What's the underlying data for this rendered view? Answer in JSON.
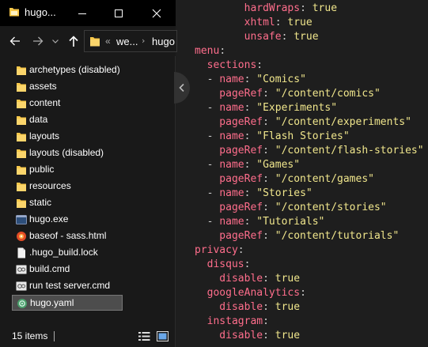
{
  "window": {
    "title": "hugo..."
  },
  "address_bar": {
    "overflow": "«",
    "segment1": "we...",
    "segment2": "hugo"
  },
  "files": [
    {
      "name": "archetypes (disabled)",
      "icon": "folder-icon"
    },
    {
      "name": "assets",
      "icon": "folder-icon"
    },
    {
      "name": "content",
      "icon": "folder-icon"
    },
    {
      "name": "data",
      "icon": "folder-icon"
    },
    {
      "name": "layouts",
      "icon": "folder-icon"
    },
    {
      "name": "layouts (disabled)",
      "icon": "folder-icon"
    },
    {
      "name": "public",
      "icon": "folder-icon"
    },
    {
      "name": "resources",
      "icon": "folder-icon"
    },
    {
      "name": "static",
      "icon": "folder-icon"
    },
    {
      "name": "hugo.exe",
      "icon": "exe-icon"
    },
    {
      "name": "baseof - sass.html",
      "icon": "html-file-icon"
    },
    {
      "name": ".hugo_build.lock",
      "icon": "blank-file-icon"
    },
    {
      "name": "build.cmd",
      "icon": "cmd-file-icon"
    },
    {
      "name": "run test server.cmd",
      "icon": "cmd-file-icon"
    },
    {
      "name": "hugo.yaml",
      "icon": "yaml-file-icon",
      "selected": true
    }
  ],
  "status": {
    "item_count": "15 items"
  },
  "colors": {
    "key": "#ff6e8c",
    "value": "#f0e68c",
    "punct": "#cccccc",
    "background": "#1e1e1e",
    "folder": "#f8c84a",
    "selection": "#4d4d4d"
  },
  "code_lines": [
    [
      [
        "k",
        "        hardWraps"
      ],
      [
        "p",
        ": "
      ],
      [
        "b",
        "true"
      ]
    ],
    [
      [
        "k",
        "        xhtml"
      ],
      [
        "p",
        ": "
      ],
      [
        "b",
        "true"
      ]
    ],
    [
      [
        "k",
        "        unsafe"
      ],
      [
        "p",
        ": "
      ],
      [
        "b",
        "true"
      ]
    ],
    [
      [
        "k",
        "menu"
      ],
      [
        "p",
        ":"
      ]
    ],
    [
      [
        "k",
        "  sections"
      ],
      [
        "p",
        ":"
      ]
    ],
    [
      [
        "p",
        "  - "
      ],
      [
        "k",
        "name"
      ],
      [
        "p",
        ": "
      ],
      [
        "s",
        "\"Comics\""
      ]
    ],
    [
      [
        "k",
        "    pageRef"
      ],
      [
        "p",
        ": "
      ],
      [
        "s",
        "\"/content/comics\""
      ]
    ],
    [
      [
        "p",
        "  - "
      ],
      [
        "k",
        "name"
      ],
      [
        "p",
        ": "
      ],
      [
        "s",
        "\"Experiments\""
      ]
    ],
    [
      [
        "k",
        "    pageRef"
      ],
      [
        "p",
        ": "
      ],
      [
        "s",
        "\"/content/experiments\""
      ]
    ],
    [
      [
        "p",
        "  - "
      ],
      [
        "k",
        "name"
      ],
      [
        "p",
        ": "
      ],
      [
        "s",
        "\"Flash Stories\""
      ]
    ],
    [
      [
        "k",
        "    pageRef"
      ],
      [
        "p",
        ": "
      ],
      [
        "s",
        "\"/content/flash-stories\""
      ]
    ],
    [
      [
        "p",
        "  - "
      ],
      [
        "k",
        "name"
      ],
      [
        "p",
        ": "
      ],
      [
        "s",
        "\"Games\""
      ]
    ],
    [
      [
        "k",
        "    pageRef"
      ],
      [
        "p",
        ": "
      ],
      [
        "s",
        "\"/content/games\""
      ]
    ],
    [
      [
        "p",
        "  - "
      ],
      [
        "k",
        "name"
      ],
      [
        "p",
        ": "
      ],
      [
        "s",
        "\"Stories\""
      ]
    ],
    [
      [
        "k",
        "    pageRef"
      ],
      [
        "p",
        ": "
      ],
      [
        "s",
        "\"/content/stories\""
      ]
    ],
    [
      [
        "p",
        "  - "
      ],
      [
        "k",
        "name"
      ],
      [
        "p",
        ": "
      ],
      [
        "s",
        "\"Tutorials\""
      ]
    ],
    [
      [
        "k",
        "    pageRef"
      ],
      [
        "p",
        ": "
      ],
      [
        "s",
        "\"/content/tutorials\""
      ]
    ],
    [
      [
        "k",
        "privacy"
      ],
      [
        "p",
        ":"
      ]
    ],
    [
      [
        "k",
        "  disqus"
      ],
      [
        "p",
        ":"
      ]
    ],
    [
      [
        "k",
        "    disable"
      ],
      [
        "p",
        ": "
      ],
      [
        "b",
        "true"
      ]
    ],
    [
      [
        "k",
        "  googleAnalytics"
      ],
      [
        "p",
        ":"
      ]
    ],
    [
      [
        "k",
        "    disable"
      ],
      [
        "p",
        ": "
      ],
      [
        "b",
        "true"
      ]
    ],
    [
      [
        "k",
        "  instagram"
      ],
      [
        "p",
        ":"
      ]
    ],
    [
      [
        "k",
        "    disable"
      ],
      [
        "p",
        ": "
      ],
      [
        "b",
        "true"
      ]
    ]
  ]
}
